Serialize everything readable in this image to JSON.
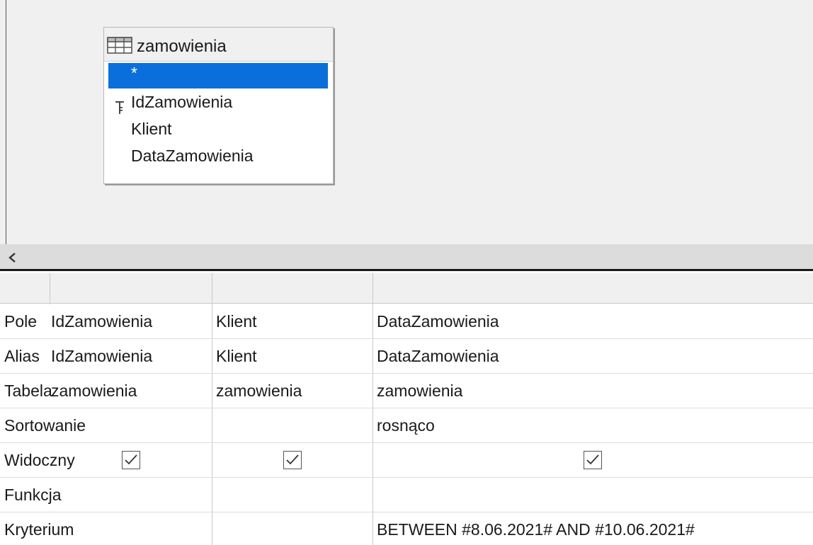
{
  "table_box": {
    "icon": "table-icon",
    "name": "zamowienia",
    "fields": [
      "*",
      "IdZamowienia",
      "Klient",
      "DataZamowienia"
    ],
    "selected_index": 0,
    "primary_key_index": 1
  },
  "scrollbar": {
    "left_arrow": "‹"
  },
  "grid": {
    "row_labels": [
      "Pole",
      "Alias",
      "Tabela",
      "Sortowanie",
      "Widoczny",
      "Funkcja",
      "Kryterium"
    ],
    "columns": [
      {
        "pole": "IdZamowienia",
        "alias": "IdZamowienia",
        "tabela": "zamowienia",
        "sortowanie": "",
        "widoczny": true,
        "funkcja": "",
        "kryterium": ""
      },
      {
        "pole": "Klient",
        "alias": "Klient",
        "tabela": "zamowienia",
        "sortowanie": "",
        "widoczny": true,
        "funkcja": "",
        "kryterium": ""
      },
      {
        "pole": "DataZamowienia",
        "alias": "DataZamowienia",
        "tabela": "zamowienia",
        "sortowanie": "rosnąco",
        "widoczny": true,
        "funkcja": "",
        "kryterium": "BETWEEN #8.06.2021# AND #10.06.2021#"
      }
    ]
  },
  "colors": {
    "selection": "#0a6fdb",
    "panel_bg": "#f0f0f0",
    "grid_line": "#dcdcdc"
  }
}
